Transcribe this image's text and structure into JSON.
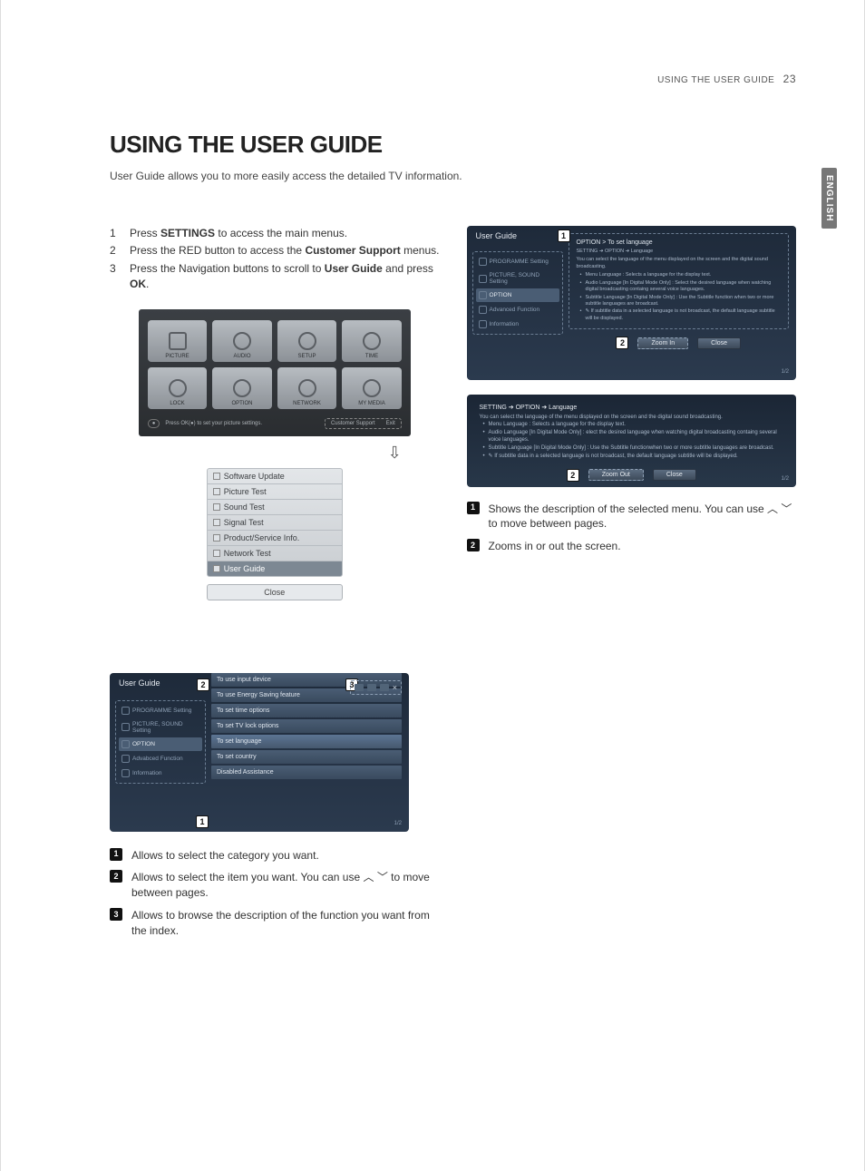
{
  "header": {
    "section": "USING THE USER GUIDE",
    "page": "23"
  },
  "sideTab": "ENGLISH",
  "title": "USING THE USER GUIDE",
  "intro": "User Guide allows you to more easily access the detailed TV information.",
  "steps": [
    {
      "n": "1",
      "pre": "Press ",
      "b": "SETTINGS",
      "post": " to access the main menus."
    },
    {
      "n": "2",
      "pre": "Press the RED button to access the ",
      "b": "Customer Support",
      "post": " menus."
    },
    {
      "n": "3",
      "pre": "Press the Navigation buttons to scroll to ",
      "b": "User Guide",
      "mid": " and press ",
      "b2": "OK",
      "post2": "."
    }
  ],
  "settingsGrid": {
    "cells": [
      "PICTURE",
      "AUDIO",
      "SETUP",
      "TIME",
      "LOCK",
      "OPTION",
      "NETWORK",
      "MY MEDIA"
    ],
    "hint": "Press OK(●) to set your picture settings.",
    "right1": "Customer Support",
    "right2": "Exit"
  },
  "csMenu": {
    "items": [
      "Software Update",
      "Picture Test",
      "Sound Test",
      "Signal Test",
      "Product/Service Info.",
      "Network Test",
      "User Guide"
    ],
    "close": "Close"
  },
  "tvRight1": {
    "title": "User Guide",
    "breadcrumb": "OPTION > To set language",
    "sidebar": [
      "PROGRAMME Setting",
      "PICTURE, SOUND Setting",
      "OPTION",
      "Advanced Function",
      "Information"
    ],
    "heading": "SETTING ➔ OPTION ➔ Language",
    "lead": "You can select the language of the menu displayed on the screen and the digital sound broadcasting.",
    "bullets": [
      "Menu Language : Selects a language for the display text.",
      "Audio Language  [In Digital Mode Only] : Select the desired language when watching digital broadcasting containg several voice languages.",
      "Subtitle Language [In Digital Mode Only] : Use the Subtitle function when two or more subtitle languages are broadcast.",
      "✎ If subtitle data in a selected language is not broadcast, the default language subtitle will be displayed."
    ],
    "btnZoom": "Zoom In",
    "btnClose": "Close",
    "page": "1/2"
  },
  "zoomShot": {
    "heading": "SETTING ➔ OPTION ➔ Language",
    "lead": "You can select the language of the menu displayed on the screen and the digital sound broadcasting.",
    "bullets": [
      "Menu Language : Selects a language for the display text.",
      "Audio Language  [In Digital Mode Only] : elect the desired language when watching digital broadcasting containg several voice languages.",
      "Subtitle Language [In Digital Mode Only] : Use the Subtitle functionwhen two or more subtitle languages are broadcast.",
      "✎ If subtitle data in a selected language is not broadcast, the default language subtitle will be displayed."
    ],
    "btnZoom": "Zoom Out",
    "btnClose": "Close",
    "page": "1/2"
  },
  "rightNotes": [
    {
      "n": "1",
      "text": "Shows the description of the selected menu. You can use ︿ ﹀ to move between pages."
    },
    {
      "n": "2",
      "text": "Zooms in or out the screen."
    }
  ],
  "tvBottom": {
    "title": "User Guide",
    "sidebar": [
      "PROGRAMME Setting",
      "PICTURE, SOUND Setting",
      "OPTION",
      "Advabced Function",
      "Information"
    ],
    "list": [
      "To use input device",
      "To use Energy Saving feature",
      "To set time options",
      "To set TV lock options",
      "To set language",
      "To set country",
      "Disabled Assistance"
    ],
    "page": "1/2"
  },
  "bottomNotes": [
    {
      "n": "1",
      "text": "Allows to select the category you want."
    },
    {
      "n": "2",
      "text": "Allows to select the item you want. You can use ︿ ﹀ to move between pages."
    },
    {
      "n": "3",
      "text": "Allows to browse the description of the function you want from the index."
    }
  ]
}
